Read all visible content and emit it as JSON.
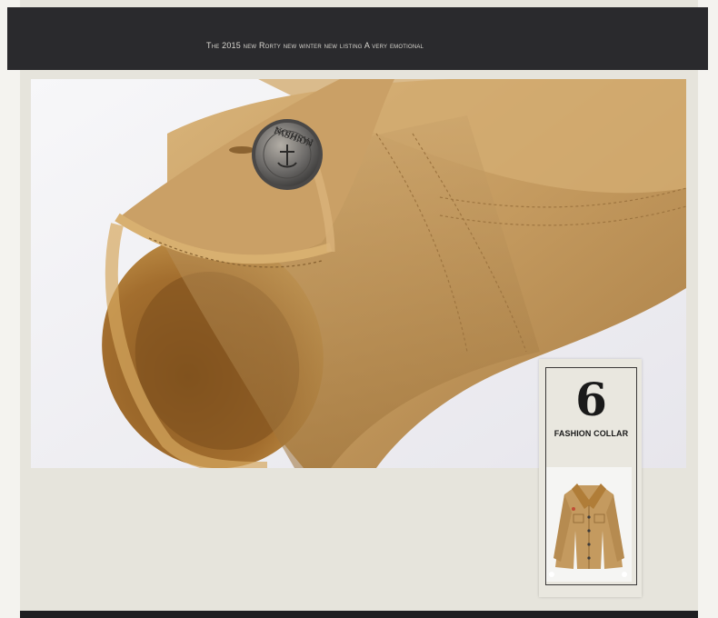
{
  "banner": {
    "text": "The 2015 new Rorty new winter new listing  A very emotional"
  },
  "feature": {
    "number": "6",
    "label": "FASHION COLLAR"
  },
  "product_image": {
    "subject": "jacket-sleeve-cuff-closeup",
    "button_text_top": "FASHION",
    "button_text_bottom": "FASHION"
  },
  "colors": {
    "fabric": "#c29a5e",
    "fleece": "#b98a3e",
    "banner": "#2a2a2d",
    "background": "#e4e2da"
  }
}
